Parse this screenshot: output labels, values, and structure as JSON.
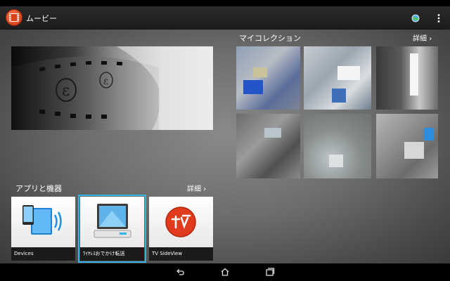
{
  "app": {
    "title": "ムービー",
    "accent": "#33b5e5",
    "icon": "film-icon"
  },
  "action_bar": {
    "icons": [
      "globe-icon",
      "overflow-menu-icon"
    ]
  },
  "collection": {
    "title": "マイコレクション",
    "detail_label": "詳細"
  },
  "apps": {
    "title": "アプリと機器",
    "detail_label": "詳細",
    "items": [
      {
        "label": "Devices",
        "icon": "devices-icon",
        "selected": false
      },
      {
        "label": "ﾜｲﾔﾚｽおでかけ転送",
        "icon": "wireless-transfer-icon",
        "selected": true
      },
      {
        "label": "TV SideView",
        "icon": "tv-sideview-icon",
        "selected": false
      }
    ]
  },
  "nav": {
    "buttons": [
      "back-icon",
      "home-icon",
      "recent-apps-icon"
    ]
  }
}
